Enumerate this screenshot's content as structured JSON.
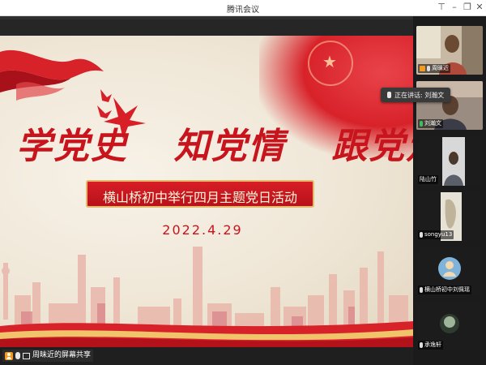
{
  "window": {
    "title": "腾讯会议"
  },
  "slide": {
    "headline_parts": [
      "学党史",
      "知党情",
      "跟党走"
    ],
    "banner": "横山桥初中举行四月主题党日活动",
    "date": "2022.4.29"
  },
  "share_status": {
    "label": "周昧近的屏幕共享"
  },
  "speaking": {
    "label": "正在讲话: 刘瀚文"
  },
  "participants": [
    {
      "name": "周昧近"
    },
    {
      "name": "刘瀚文"
    },
    {
      "name": "陆山竹"
    },
    {
      "name": "songyu13"
    },
    {
      "name": "横山桥初中刘佩瑶"
    },
    {
      "name": "承逸轩"
    }
  ],
  "colors": {
    "accent_red": "#c8141c",
    "speaking_border": "#3fbf5c",
    "host_orange": "#f39a1f"
  }
}
